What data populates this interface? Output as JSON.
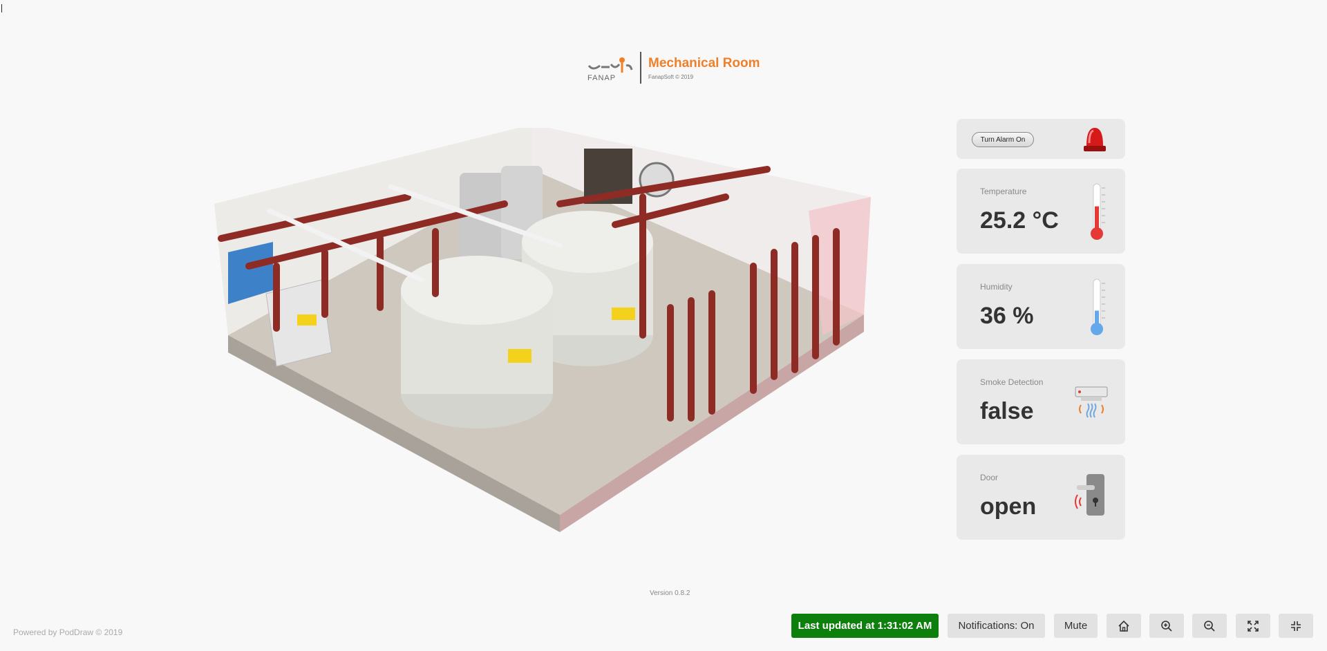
{
  "header": {
    "title": "Mechanical Room",
    "subtitle": "FanapSoft © 2019",
    "logo_text": "FANAP"
  },
  "alarm": {
    "button_label": "Turn Alarm On",
    "icon": "siren-icon"
  },
  "metrics": [
    {
      "label": "Temperature",
      "value": "25.2 °C",
      "icon": "thermometer-icon",
      "level": 0.55,
      "color": "#e53935"
    },
    {
      "label": "Humidity",
      "value": "36 %",
      "icon": "thermometer-icon",
      "level": 0.36,
      "color": "#64a7ea"
    },
    {
      "label": "Smoke Detection",
      "value": "false",
      "icon": "smoke-detector-icon"
    },
    {
      "label": "Door",
      "value": "open",
      "icon": "door-lock-icon"
    }
  ],
  "footer": {
    "version": "Version 0.8.2",
    "powered_by": "Powered by PodDraw © 2019",
    "last_updated": "Last updated at 1:31:02 AM",
    "notifications": "Notifications: On",
    "mute": "Mute"
  },
  "toolbar_icons": [
    "home-icon",
    "zoom-in-icon",
    "zoom-out-icon",
    "expand-icon",
    "compress-icon"
  ],
  "colors": {
    "accent": "#f07f2a",
    "success": "#0d7f0d",
    "card_bg": "#e9e9e9"
  }
}
